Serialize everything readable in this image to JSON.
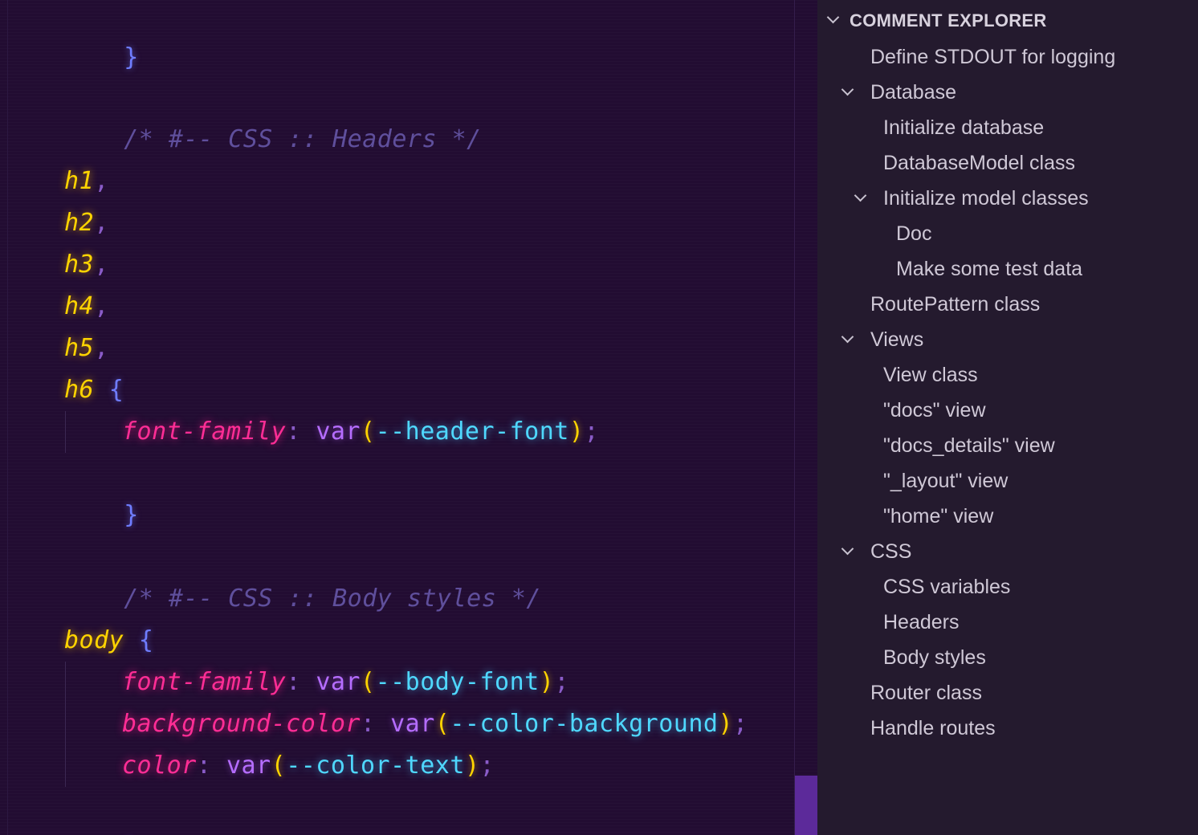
{
  "editor": {
    "lines": {
      "close0": "}",
      "comment_headers": "/* #-- CSS :: Headers */",
      "h1": "h1",
      "h2": "h2",
      "h3": "h3",
      "h4": "h4",
      "h5": "h5",
      "h6": "h6",
      "comma": ",",
      "open_brace": "{",
      "close_brace": "}",
      "semicolon": ";",
      "colon": ":",
      "var_kw": "var",
      "lparen": "(",
      "rparen": ")",
      "prop_font_family": "font-family",
      "val_header_font": "--header-font",
      "comment_body": "/* #-- CSS :: Body styles */",
      "body_sel": "body",
      "val_body_font": "--body-font",
      "prop_background_color": "background-color",
      "val_color_background": "--color-background",
      "prop_color": "color",
      "val_color_text": "--color-text"
    }
  },
  "sidebar": {
    "title": "COMMENT EXPLORER",
    "items": [
      {
        "label": "Define STDOUT for logging"
      },
      {
        "label": "Database"
      },
      {
        "label": "Initialize database"
      },
      {
        "label": "DatabaseModel class"
      },
      {
        "label": "Initialize model classes"
      },
      {
        "label": "Doc"
      },
      {
        "label": "Make some test data"
      },
      {
        "label": "RoutePattern class"
      },
      {
        "label": "Views"
      },
      {
        "label": "View class"
      },
      {
        "label": "\"docs\" view"
      },
      {
        "label": "\"docs_details\" view"
      },
      {
        "label": "\"_layout\" view"
      },
      {
        "label": "\"home\" view"
      },
      {
        "label": "CSS"
      },
      {
        "label": "CSS variables"
      },
      {
        "label": "Headers"
      },
      {
        "label": "Body styles"
      },
      {
        "label": "Router class"
      },
      {
        "label": "Handle routes"
      }
    ]
  },
  "colors": {
    "editor_bg": "#220c32",
    "sidebar_bg": "#241a2e",
    "selector": "#ffd400",
    "property": "#ff2d95",
    "variable": "#4fd8ff",
    "keyword": "#b56dff",
    "brace": "#6f7dff",
    "comment": "#5f4f9c",
    "scroll_thumb": "#5c2a9a"
  }
}
